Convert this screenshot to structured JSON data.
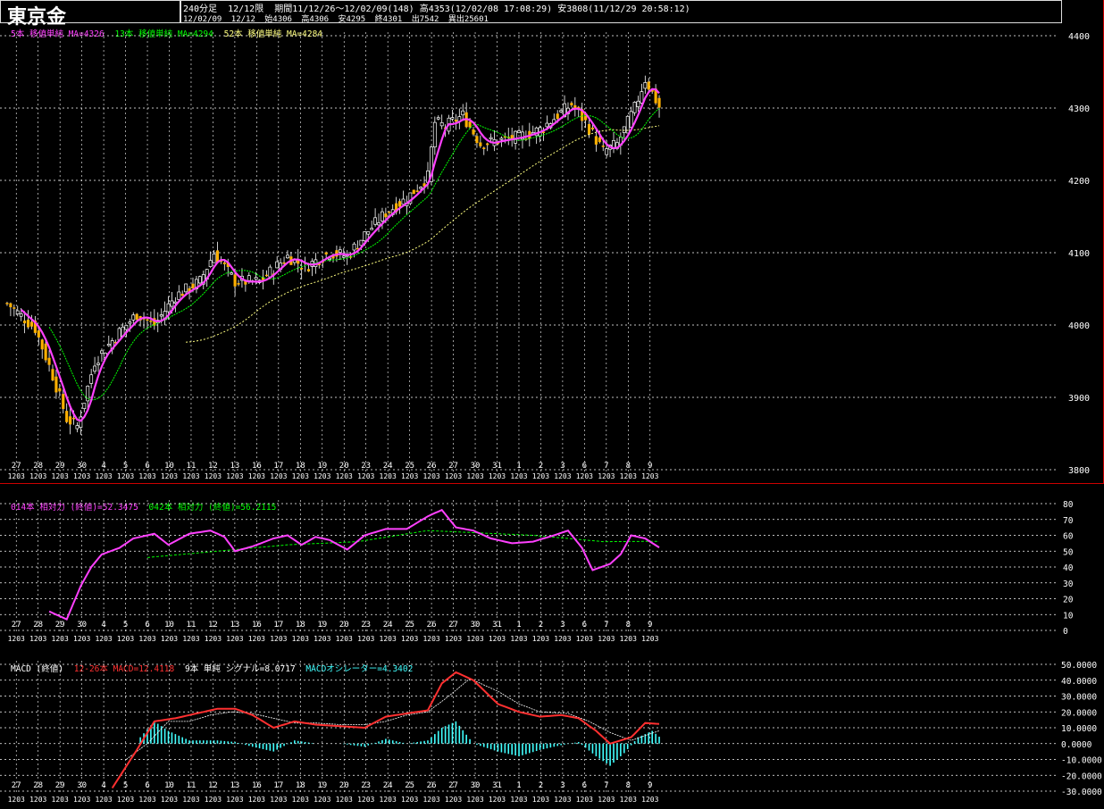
{
  "header": {
    "title": "東京金",
    "line1": [
      "240分足",
      "12/12限",
      "期間11/12/26～12/02/09(148)",
      "高4353(12/02/08 17:08:29)",
      "安3808(11/12/29 20:58:12)"
    ],
    "line2": [
      "12/02/09",
      "12/12",
      "始4306",
      "高4306",
      "安4295",
      "終4301",
      "出7542",
      "異出25601"
    ]
  },
  "legends": {
    "price": [
      {
        "text": "5本 移値単純 MA=4326",
        "color": "#ff40ff"
      },
      {
        "text": "13本 移値単純 MA=4294",
        "color": "#00ff00"
      },
      {
        "text": "52本 移値単純 MA=4284",
        "color": "#ffff80"
      }
    ],
    "rsi": [
      {
        "text": "014本 相対力 (終値)=52.3475",
        "color": "#ff40ff"
      },
      {
        "text": "042本 相対力 (終値)=56.2115",
        "color": "#00ff00"
      }
    ],
    "macd": [
      {
        "text": "MACD (終値)",
        "color": "#ffffff"
      },
      {
        "text": "12-26本 MACD=12.4118",
        "color": "#ff3030"
      },
      {
        "text": "9本 単純 シグナル=8.0717",
        "color": "#ffffff"
      },
      {
        "text": "MACDオシレーター=4.3402",
        "color": "#40ffff"
      }
    ]
  },
  "colors": {
    "background": "#000000",
    "grid": "#ffffff",
    "candle_body": "#ffb000",
    "candle_wick": "#ffffff",
    "ma5": "#ff40ff",
    "ma13": "#00ff00",
    "ma52": "#ffff80",
    "rsi14": "#ff40ff",
    "rsi42": "#00ff00",
    "macd": "#ff3030",
    "signal": "#ffffff",
    "oscillator": "#40ffff",
    "frame": "#cc0000"
  },
  "chart_data": [
    {
      "type": "candlestick",
      "name": "price",
      "ylim": [
        3800,
        4400
      ],
      "yticks": [
        3800,
        3900,
        4000,
        4100,
        4200,
        4300,
        4400
      ],
      "grid": true,
      "day_labels": [
        "27",
        "28",
        "29",
        "30",
        "4",
        "5",
        "6",
        "10",
        "11",
        "12",
        "13",
        "16",
        "17",
        "18",
        "19",
        "20",
        "23",
        "24",
        "25",
        "26",
        "27",
        "30",
        "31",
        "1",
        "2",
        "3",
        "6",
        "7",
        "8",
        "9"
      ],
      "date_label": "1203",
      "ohlc_keypoints": [
        [
          0,
          4030
        ],
        [
          8,
          3995
        ],
        [
          13,
          3930
        ],
        [
          17,
          3870
        ],
        [
          20,
          3860
        ],
        [
          25,
          3950
        ],
        [
          32,
          3990
        ],
        [
          37,
          4015
        ],
        [
          42,
          4000
        ],
        [
          48,
          4040
        ],
        [
          55,
          4060
        ],
        [
          59,
          4100
        ],
        [
          65,
          4060
        ],
        [
          72,
          4060
        ],
        [
          80,
          4095
        ],
        [
          85,
          4080
        ],
        [
          92,
          4100
        ],
        [
          97,
          4095
        ],
        [
          102,
          4125
        ],
        [
          108,
          4155
        ],
        [
          114,
          4175
        ],
        [
          120,
          4205
        ],
        [
          122,
          4280
        ],
        [
          125,
          4275
        ],
        [
          130,
          4290
        ],
        [
          135,
          4250
        ],
        [
          140,
          4255
        ],
        [
          146,
          4260
        ],
        [
          152,
          4270
        ],
        [
          157,
          4290
        ],
        [
          161,
          4305
        ],
        [
          165,
          4280
        ],
        [
          170,
          4240
        ],
        [
          174,
          4250
        ],
        [
          179,
          4300
        ],
        [
          182,
          4340
        ],
        [
          186,
          4301
        ]
      ],
      "ma_values": {
        "ma5": 4326,
        "ma13": 4294,
        "ma52": 4284
      }
    },
    {
      "type": "line",
      "name": "rsi",
      "ylim": [
        0,
        80
      ],
      "yticks": [
        0,
        10,
        20,
        30,
        40,
        50,
        60,
        70,
        80
      ],
      "series": [
        {
          "name": "014本 相対力 (終値)",
          "keypoints": [
            [
              12,
              12
            ],
            [
              17,
              7
            ],
            [
              21,
              28
            ],
            [
              24,
              40
            ],
            [
              27,
              48
            ],
            [
              32,
              52
            ],
            [
              36,
              58
            ],
            [
              42,
              61
            ],
            [
              46,
              54
            ],
            [
              52,
              61
            ],
            [
              58,
              63
            ],
            [
              62,
              59
            ],
            [
              65,
              50
            ],
            [
              70,
              53
            ],
            [
              76,
              58
            ],
            [
              80,
              60
            ],
            [
              84,
              54
            ],
            [
              88,
              59
            ],
            [
              92,
              57
            ],
            [
              97,
              51
            ],
            [
              102,
              60
            ],
            [
              108,
              64
            ],
            [
              114,
              64
            ],
            [
              120,
              72
            ],
            [
              124,
              76
            ],
            [
              128,
              65
            ],
            [
              133,
              63
            ],
            [
              138,
              58
            ],
            [
              144,
              55
            ],
            [
              150,
              56
            ],
            [
              156,
              60
            ],
            [
              160,
              63
            ],
            [
              164,
              52
            ],
            [
              167,
              38
            ],
            [
              172,
              42
            ],
            [
              175,
              48
            ],
            [
              178,
              60
            ],
            [
              182,
              58
            ],
            [
              186,
              52.3475
            ]
          ]
        },
        {
          "name": "042本 相対力 (終値)",
          "keypoints": [
            [
              40,
              46
            ],
            [
              60,
              50
            ],
            [
              80,
              54
            ],
            [
              100,
              56
            ],
            [
              120,
              63
            ],
            [
              130,
              62
            ],
            [
              150,
              60
            ],
            [
              170,
              56
            ],
            [
              186,
              56.2115
            ]
          ]
        }
      ]
    },
    {
      "type": "line",
      "name": "macd",
      "ylim": [
        -30,
        50
      ],
      "yticks": [
        -30,
        -20,
        -10,
        0,
        10,
        20,
        30,
        40,
        50
      ],
      "tick_labels": [
        "-30.0000",
        "-20.0000",
        "-10.0000",
        "0.0000",
        "10.0000",
        "20.0000",
        "30.0000",
        "40.0000",
        "50.0000"
      ],
      "series": [
        {
          "name": "12-26本 MACD",
          "keypoints": [
            [
              30,
              -28
            ],
            [
              37,
              -4
            ],
            [
              42,
              14
            ],
            [
              48,
              16
            ],
            [
              54,
              19
            ],
            [
              60,
              22
            ],
            [
              65,
              22
            ],
            [
              70,
              18
            ],
            [
              76,
              10
            ],
            [
              82,
              14
            ],
            [
              88,
              12
            ],
            [
              95,
              11
            ],
            [
              102,
              10
            ],
            [
              108,
              17
            ],
            [
              114,
              19
            ],
            [
              120,
              21
            ],
            [
              124,
              38
            ],
            [
              128,
              45
            ],
            [
              133,
              40
            ],
            [
              140,
              25
            ],
            [
              146,
              20
            ],
            [
              152,
              17
            ],
            [
              158,
              18
            ],
            [
              163,
              16
            ],
            [
              168,
              8
            ],
            [
              172,
              0
            ],
            [
              178,
              4
            ],
            [
              182,
              13
            ],
            [
              186,
              12.4118
            ]
          ]
        },
        {
          "name": "9本 単純 シグナル",
          "keypoints": [
            [
              34,
              -10
            ],
            [
              40,
              0
            ],
            [
              46,
              14
            ],
            [
              52,
              14
            ],
            [
              58,
              18
            ],
            [
              64,
              20
            ],
            [
              70,
              19
            ],
            [
              76,
              16
            ],
            [
              82,
              13
            ],
            [
              88,
              13
            ],
            [
              95,
              12
            ],
            [
              102,
              12
            ],
            [
              108,
              14
            ],
            [
              114,
              18
            ],
            [
              120,
              20
            ],
            [
              126,
              30
            ],
            [
              132,
              41
            ],
            [
              140,
              33
            ],
            [
              146,
              25
            ],
            [
              152,
              20
            ],
            [
              160,
              19
            ],
            [
              166,
              14
            ],
            [
              172,
              7
            ],
            [
              178,
              2
            ],
            [
              186,
              8.0717
            ]
          ]
        },
        {
          "name": "MACDオシレーター",
          "keypoints": [
            [
              38,
              4
            ],
            [
              42,
              14
            ],
            [
              46,
              8
            ],
            [
              52,
              2
            ],
            [
              60,
              2
            ],
            [
              65,
              1
            ],
            [
              70,
              -2
            ],
            [
              76,
              -5
            ],
            [
              82,
              2
            ],
            [
              88,
              0
            ],
            [
              95,
              0
            ],
            [
              102,
              -2
            ],
            [
              108,
              3
            ],
            [
              114,
              0
            ],
            [
              120,
              2
            ],
            [
              124,
              10
            ],
            [
              128,
              14
            ],
            [
              133,
              0
            ],
            [
              140,
              -5
            ],
            [
              146,
              -8
            ],
            [
              152,
              -4
            ],
            [
              158,
              -1
            ],
            [
              163,
              1
            ],
            [
              168,
              -8
            ],
            [
              172,
              -14
            ],
            [
              176,
              -6
            ],
            [
              180,
              4
            ],
            [
              184,
              8
            ],
            [
              186,
              4.3402
            ]
          ]
        }
      ]
    }
  ]
}
